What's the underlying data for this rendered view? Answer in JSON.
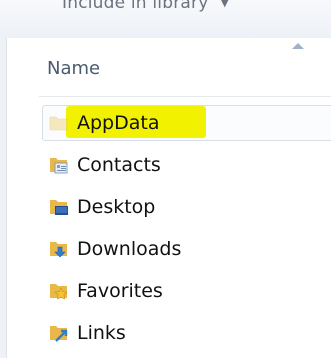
{
  "toolbar": {
    "include_in_library_label": "Include in library",
    "dropdown_icon": "chevron-down-icon"
  },
  "columns": {
    "name_header": "Name",
    "sort_icon": "sort-up-icon"
  },
  "files": [
    {
      "label": "AppData",
      "icon": "hidden-folder-icon",
      "selected": true,
      "highlighted": true
    },
    {
      "label": "Contacts",
      "icon": "contacts-folder-icon"
    },
    {
      "label": "Desktop",
      "icon": "desktop-folder-icon"
    },
    {
      "label": "Downloads",
      "icon": "downloads-folder-icon"
    },
    {
      "label": "Favorites",
      "icon": "favorites-folder-icon"
    },
    {
      "label": "Links",
      "icon": "links-folder-icon"
    }
  ],
  "colors": {
    "highlight": "#f1f100",
    "folder": "#e8b84a",
    "header_text": "#4a5a6f"
  }
}
